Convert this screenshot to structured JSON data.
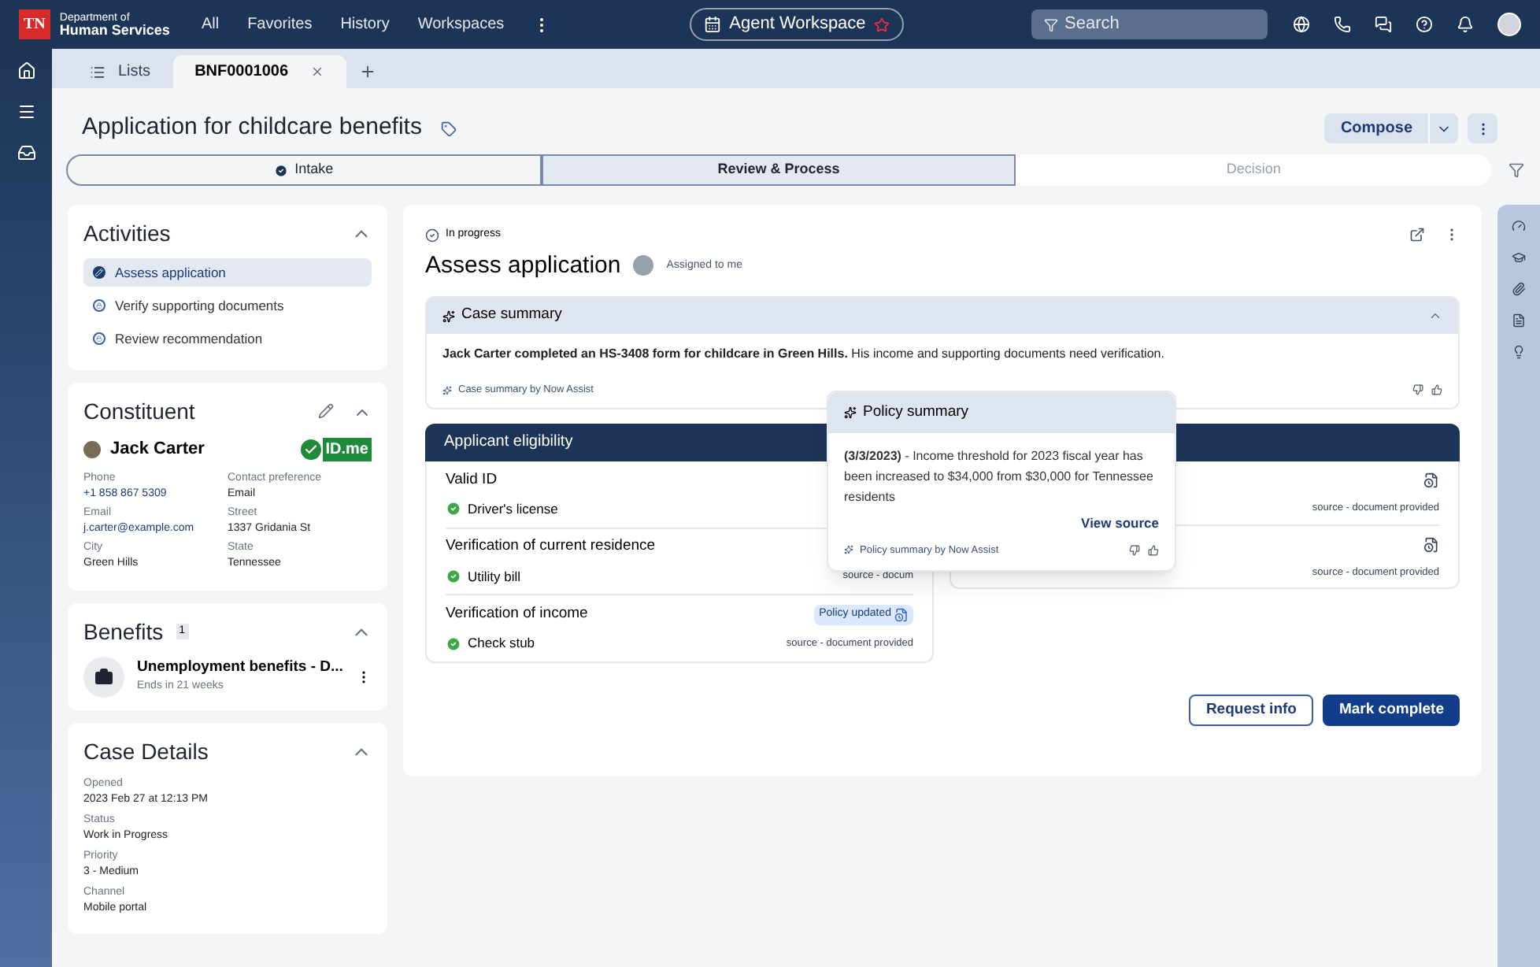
{
  "header": {
    "logo": "TN",
    "org_line1": "Department of",
    "org_line2": "Human Services",
    "nav": [
      "All",
      "Favorites",
      "History",
      "Workspaces"
    ],
    "workspace": "Agent Workspace",
    "search": {
      "placeholder": "Search"
    }
  },
  "tabs": [
    {
      "label": "Lists",
      "selected": false,
      "closable": false
    },
    {
      "label": "BNF0001006",
      "selected": true,
      "closable": true
    }
  ],
  "title": "Application for childcare benefits",
  "compose": "Compose",
  "stages": [
    {
      "label": "Intake",
      "done": true,
      "selected": false
    },
    {
      "label": "Review & Process",
      "done": false,
      "selected": true
    },
    {
      "label": "Decision",
      "done": false,
      "selected": false
    }
  ],
  "activities": {
    "title": "Activities",
    "items": [
      {
        "label": "Assess application",
        "selected": true
      },
      {
        "label": "Verify supporting documents",
        "selected": false
      },
      {
        "label": "Review recommendation",
        "selected": false
      }
    ]
  },
  "constituent": {
    "title": "Constituent",
    "name": "Jack Carter",
    "idme": "ID.me",
    "fields": [
      {
        "label": "Phone",
        "value": "+1 858 867 5309",
        "link": true
      },
      {
        "label": "Contact preference",
        "value": "Email",
        "link": false
      },
      {
        "label": "Email",
        "value": "j.carter@example.com",
        "link": true
      },
      {
        "label": "Street",
        "value": "1337 Gridania St",
        "link": false
      },
      {
        "label": "City",
        "value": "Green Hills",
        "link": false
      },
      {
        "label": "State",
        "value": "Tennessee",
        "link": false
      }
    ]
  },
  "benefits": {
    "title": "Benefits",
    "count": "1",
    "item": "Unemployment benefits - D...",
    "sub": "Ends in 21 weeks"
  },
  "case_details": {
    "title": "Case Details",
    "fields": [
      {
        "label": "Opened",
        "value": "2023 Feb 27 at 12:13 PM"
      },
      {
        "label": "Status",
        "value": "Work in Progress"
      },
      {
        "label": "Priority",
        "value": "3 - Medium"
      },
      {
        "label": "Channel",
        "value": "Mobile portal"
      }
    ]
  },
  "task": {
    "status": "In progress",
    "title": "Assess application",
    "assigned": "Assigned to me",
    "summary": {
      "title": "Case summary",
      "text": "**Jack Carter completed an HS-3408 form for childcare in Green Hills.** His income and supporting documents need verification.",
      "credit": "Case summary by Now Assist"
    },
    "eligibility": {
      "title": "Applicant eligibility",
      "left_rows": [
        {
          "title": "Valid ID",
          "item": "Driver's license"
        },
        {
          "title": "Verification of current residence",
          "item": "Utility bill",
          "source": "source - docum"
        },
        {
          "title": "Verification of income",
          "item": "Check stub",
          "source": "source - document provided",
          "badge": "Policy updated"
        }
      ],
      "right_rows": [
        {
          "source": "source - document provided"
        },
        {
          "source": "source - document provided"
        }
      ]
    },
    "popover": {
      "title": "Policy summary",
      "text": "**(3/3/2023)** - Income threshold for 2023 fiscal year has been increased to $34,000 from $30,000 for Tennessee residents",
      "link": "View source",
      "credit": "Policy summary by Now Assist"
    },
    "buttons": [
      "Request info",
      "Mark complete"
    ]
  }
}
